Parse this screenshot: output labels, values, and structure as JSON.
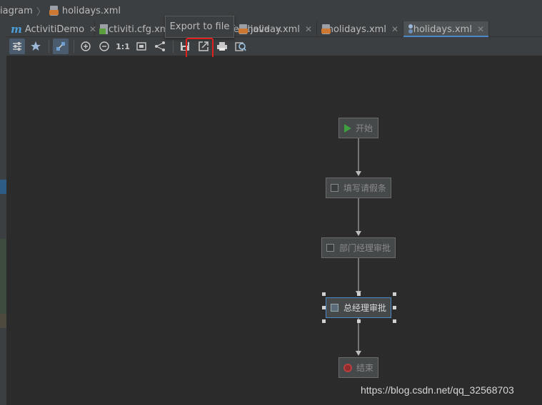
{
  "breadcrumb": {
    "items": [
      "iagram",
      "holidays.xml"
    ]
  },
  "tabs": [
    {
      "label": "ActivitiDemo",
      "icon": "module-m-icon"
    },
    {
      "label": "activiti.cfg.xml",
      "icon": "xml-config-icon"
    },
    {
      "label": "Test.java",
      "icon": "java-file-icon"
    },
    {
      "label": "holiday.xml",
      "icon": "xml-file-icon"
    },
    {
      "label": "holidays.xml",
      "icon": "xml-file-icon"
    },
    {
      "label": "holidays.xml",
      "icon": "diagram-icon",
      "active": true
    }
  ],
  "toolbar": {
    "actual_size_label": "1:1",
    "buttons": [
      "properties-icon",
      "auto-layout-icon",
      "link-icon",
      "zoom-in-icon",
      "zoom-out-icon",
      "actual-size-icon",
      "fit-content-icon",
      "layout-icon",
      "save-icon",
      "export-icon",
      "print-icon",
      "print-preview-icon"
    ]
  },
  "tooltip": {
    "text": "Export to file"
  },
  "diagram": {
    "nodes": [
      {
        "id": "start",
        "label": "开始",
        "type": "start-event"
      },
      {
        "id": "task1",
        "label": "填写请假条",
        "type": "user-task"
      },
      {
        "id": "task2",
        "label": "部门经理审批",
        "type": "user-task"
      },
      {
        "id": "task3",
        "label": "总经理审批",
        "type": "user-task",
        "selected": true
      },
      {
        "id": "end",
        "label": "结束",
        "type": "end-event"
      }
    ]
  },
  "watermark": {
    "text": "https://blog.csdn.net/qq_32568703"
  },
  "colors": {
    "accent": "#4a88c7",
    "highlight": "#e0201c",
    "background": "#2b2b2b"
  }
}
